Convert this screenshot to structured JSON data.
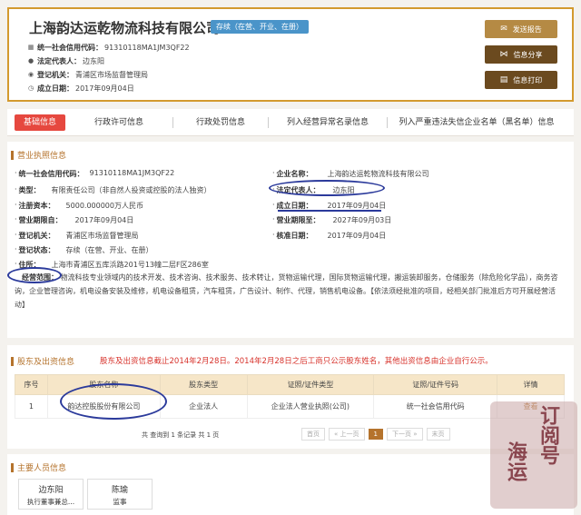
{
  "header": {
    "company_name": "上海韵达运乾物流科技有限公司",
    "status": "存续（在营、开业、在册）",
    "rows": [
      {
        "label": "统一社会信用代码：",
        "value": "91310118MA1JM3QF22"
      },
      {
        "label": "法定代表人：",
        "value": "边东阳"
      },
      {
        "label": "登记机关：",
        "value": "青浦区市场监督管理局"
      },
      {
        "label": "成立日期：",
        "value": "2017年09月04日"
      }
    ],
    "buttons": {
      "report": "发送报告",
      "share": "信息分享",
      "print": "信息打印"
    }
  },
  "tabs": [
    "基础信息",
    "行政许可信息",
    "行政处罚信息",
    "列入经营异常名录信息",
    "列入严重违法失信企业名单（黑名单）信息"
  ],
  "license": {
    "section_title": "营业执照信息",
    "left": [
      {
        "label": "统一社会信用代码：",
        "value": "91310118MA1JM3QF22"
      },
      {
        "label": "类型：",
        "value": "有限责任公司（非自然人投资或控股的法人独资）"
      },
      {
        "label": "注册资本：",
        "value": "5000.000000万人民币"
      },
      {
        "label": "营业期限自：",
        "value": "2017年09月04日"
      },
      {
        "label": "登记机关：",
        "value": "青浦区市场监督管理局"
      },
      {
        "label": "登记状态：",
        "value": "存续（在营、开业、在册）"
      },
      {
        "label": "住所：",
        "value": "上海市青浦区五库浜路201号13幢二层F区286室"
      }
    ],
    "right": [
      {
        "label": "企业名称：",
        "value": "上海韵达运乾物流科技有限公司"
      },
      {
        "label": "法定代表人：",
        "value": "边东阳"
      },
      {
        "label": "成立日期：",
        "value": "2017年09月04日"
      },
      {
        "label": "营业期限至：",
        "value": "2027年09月03日"
      },
      {
        "label": "核准日期：",
        "value": "2017年09月04日"
      }
    ],
    "scope_label": "经营范围：",
    "scope_value": "物流科技专业领域内的技术开发、技术咨询、技术服务、技术转让，货物运输代理，国际货物运输代理，搬运装卸服务，仓储服务（除危险化学品），商务咨询，企业管理咨询，机电设备安装及维修，机电设备租赁，汽车租赁，广告设计、制作、代理，销售机电设备。【依法须经批准的项目，经相关部门批准后方可开展经营活动】"
  },
  "shareholders": {
    "section_title": "股东及出资信息",
    "note": "股东及出资信息截止2014年2月28日。2014年2月28日之后工商只公示股东姓名，其他出资信息由企业自行公示。",
    "columns": [
      "序号",
      "股东名称",
      "股东类型",
      "证照/证件类型",
      "证照/证件号码",
      "详情"
    ],
    "rows": [
      [
        "1",
        "韵达控股股份有限公司",
        "企业法人",
        "企业法人营业执照(公司)",
        "统一社会信用代码",
        "查看"
      ]
    ],
    "count_text": "共 查询到 1 条记录 共 1 页",
    "pager": [
      "首页",
      "« 上一页",
      "1",
      "下一页 »",
      "末页"
    ]
  },
  "personnel": {
    "section_title": "主要人员信息",
    "people": [
      {
        "name": "边东阳",
        "role": "执行董事兼总..."
      },
      {
        "name": "陈瑜",
        "role": "监事"
      }
    ]
  },
  "watermark_text": [
    "订阅号",
    "海运"
  ],
  "colors": {
    "accent": "#b5732c",
    "active_tab": "#e6483f",
    "annotation": "#2b3a9b",
    "status": "#4a94c9"
  }
}
